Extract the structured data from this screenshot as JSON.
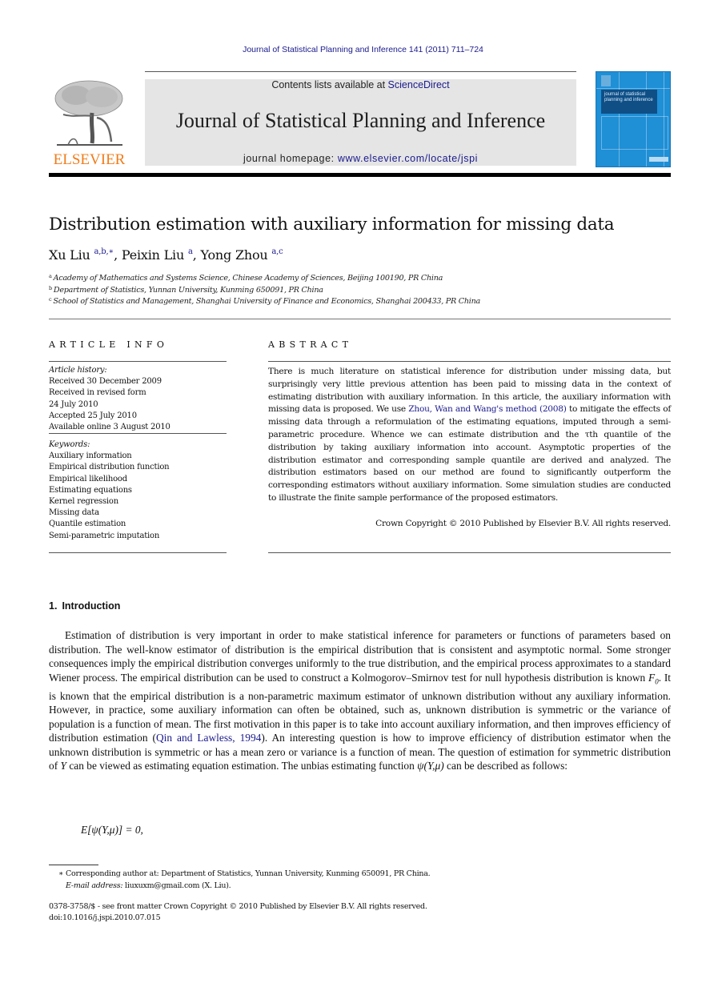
{
  "running_head": "Journal of Statistical Planning and Inference 141 (2011) 711–724",
  "masthead": {
    "publisher_logo_text": "ELSEVIER",
    "contents_prefix": "Contents lists available at ",
    "contents_link": "ScienceDirect",
    "journal_title": "Journal of Statistical Planning and Inference",
    "homepage_prefix": "journal homepage: ",
    "homepage_link": "www.elsevier.com/locate/jspi",
    "cover_title": "journal of statistical planning and inference",
    "colors": {
      "logo_orange": "#f07c1a",
      "link_blue": "#1a1a8c",
      "cover_blue": "#1f8fd6",
      "banner_gray": "#e5e5e5"
    }
  },
  "article": {
    "title": "Distribution estimation with auxiliary information for missing data",
    "authors": [
      {
        "name": "Xu Liu",
        "sup": "a,b,∗",
        "sep": ", "
      },
      {
        "name": "Peixin Liu",
        "sup": "a",
        "sep": ", "
      },
      {
        "name": "Yong Zhou",
        "sup": "a,c",
        "sep": ""
      }
    ],
    "affiliations": [
      {
        "key": "a",
        "text": "Academy of Mathematics and Systems Science, Chinese Academy of Sciences, Beijing 100190, PR China"
      },
      {
        "key": "b",
        "text": "Department of Statistics, Yunnan University, Kunming 650091, PR China"
      },
      {
        "key": "c",
        "text": "School of Statistics and Management, Shanghai University of Finance and Economics, Shanghai 200433, PR China"
      }
    ]
  },
  "article_info": {
    "heading": "ARTICLE INFO",
    "history_label": "Article history:",
    "history": [
      "Received 30 December 2009",
      "Received in revised form",
      "24 July 2010",
      "Accepted 25 July 2010",
      "Available online 3 August 2010"
    ],
    "keywords_label": "Keywords:",
    "keywords": [
      "Auxiliary information",
      "Empirical distribution function",
      "Empirical likelihood",
      "Estimating equations",
      "Kernel regression",
      "Missing data",
      "Quantile estimation",
      "Semi-parametric imputation"
    ]
  },
  "abstract": {
    "heading": "ABSTRACT",
    "part1": "There is much literature on statistical inference for distribution under missing data, but surprisingly very little previous attention has been paid to missing data in the context of estimating distribution with auxiliary information. In this article, the auxiliary information with missing data is proposed. We use ",
    "citation": "Zhou, Wan and Wang's method (2008)",
    "part2": " to mitigate the effects of missing data through a reformulation of the estimating equations, imputed through a semi-parametric procedure. Whence we can estimate distribution and the τth quantile of the distribution by taking auxiliary information into account. Asymptotic properties of the distribution estimator and corresponding sample quantile are derived and analyzed. The distribution estimators based on our method are found to significantly outperform the corresponding estimators without auxiliary information. Some simulation studies are conducted to illustrate the finite sample performance of the proposed estimators.",
    "copyright": "Crown Copyright © 2010 Published by Elsevier B.V. All rights reserved."
  },
  "introduction": {
    "number": "1.",
    "title": "Introduction",
    "part1": "Estimation of distribution is very important in order to make statistical inference for parameters or functions of parameters based on distribution. The well-know estimator of distribution is the empirical distribution that is consistent and asymptotic normal. Some stronger consequences imply the empirical distribution converges uniformly to the true distribution, and the empirical process approximates to a standard Wiener process. The empirical distribution can be used to construct a Kolmogorov–Smirnov test for null hypothesis distribution is known ",
    "f0_base": "F",
    "f0_sub": "0",
    "part2": ". It is known that the empirical distribution is a non-parametric maximum estimator of unknown distribution without any auxiliary information. However, in practice, some auxiliary information can often be obtained, such as, unknown distribution is symmetric or the variance of population is a function of mean. The first motivation in this paper is to take into account auxiliary information, and then improves efficiency of distribution estimation (",
    "citation": "Qin and Lawless, 1994",
    "part3": "). An interesting question is how to improve efficiency of distribution estimator when the unknown distribution is symmetric or has a mean zero or variance is a function of mean. The question of estimation for symmetric distribution of ",
    "var_y": "Y",
    "part4": " can be viewed as estimating equation estimation. The unbias estimating function ",
    "psi": "ψ(Y,μ)",
    "part5": " can be described as follows:",
    "equation": "E[ψ(Y,μ)] = 0,"
  },
  "footnotes": {
    "corresponding": "∗ Corresponding author at: Department of Statistics, Yunnan University, Kunming 650091, PR China.",
    "email_label": "E-mail address:",
    "email": " liuxuxm@gmail.com (X. Liu).",
    "issn_line": "0378-3758/$ - see front matter Crown Copyright © 2010 Published by Elsevier B.V. All rights reserved.",
    "doi": "doi:10.1016/j.jspi.2010.07.015"
  }
}
